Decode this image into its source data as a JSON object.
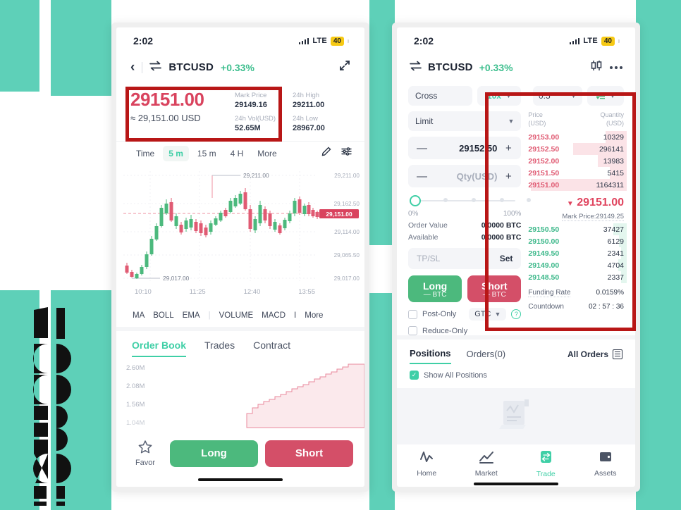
{
  "theme": {
    "teal": "#5ed0b8",
    "accent_green": "#3fcfa6",
    "red": "#d9435e",
    "long_green": "#4cb97d",
    "short_red": "#d44f68",
    "annotation_red": "#b81616"
  },
  "left_phone": {
    "status": {
      "time": "2:02",
      "network": "LTE",
      "battery": "40"
    },
    "header": {
      "back_icon": "chevron-left-icon",
      "swap_icon": "swap-icon",
      "pair": "BTCUSD",
      "change": "+0.33%",
      "expand_icon": "expand-icon"
    },
    "price": {
      "last": "29151.00",
      "approx": "≈ 29,151.00 USD",
      "stats": [
        {
          "label": "Mark Price",
          "value": "29149.16"
        },
        {
          "label": "24h High",
          "value": "29211.00"
        },
        {
          "label": "24h Vol(USD)",
          "value": "52.65M"
        },
        {
          "label": "24h Low",
          "value": "28967.00"
        }
      ]
    },
    "timeframes": [
      {
        "label": "Time",
        "active": false
      },
      {
        "label": "5 m",
        "active": true
      },
      {
        "label": "15 m",
        "active": false
      },
      {
        "label": "4 H",
        "active": false
      },
      {
        "label": "More",
        "active": false
      }
    ],
    "timeframe_icons": [
      "pencil-icon",
      "settings-sliders-icon"
    ],
    "indicators": [
      "MA",
      "BOLL",
      "EMA",
      "VOLUME",
      "MACD",
      "I",
      "More"
    ],
    "order_book_tabs": [
      {
        "label": "Order Book",
        "active": true
      },
      {
        "label": "Trades",
        "active": false
      },
      {
        "label": "Contract",
        "active": false
      }
    ],
    "depth_labels": [
      "2.60M",
      "2.08M",
      "1.56M",
      "1.04M"
    ],
    "bottom": {
      "favor_icon": "star-icon",
      "favor_label": "Favor",
      "long_label": "Long",
      "short_label": "Short"
    }
  },
  "right_phone": {
    "status": {
      "time": "2:02",
      "network": "LTE",
      "battery": "40"
    },
    "header": {
      "swap_icon": "swap-icon",
      "pair": "BTCUSD",
      "change": "+0.33%",
      "candle_icon": "candlestick-icon",
      "more_icon": "more-dots-icon"
    },
    "order_form": {
      "margin_mode": "Cross",
      "leverage": "10x",
      "tick_size": "0.5",
      "depth_icon": "order-depth-icon",
      "order_type": "Limit",
      "price_value": "29152.50",
      "qty_placeholder": "Qty(USD)",
      "minus": "—",
      "plus": "+",
      "slider_min": "0%",
      "slider_max": "100%",
      "order_value_label": "Order Value",
      "order_value": "0.0000 BTC",
      "available_label": "Available",
      "available": "0.0000 BTC",
      "tpsl_label": "TP/SL",
      "tpsl_set": "Set",
      "long_label": "Long",
      "long_sub": "— BTC",
      "short_label": "Short",
      "short_sub": "— BTC",
      "post_only": "Post-Only",
      "reduce_only": "Reduce-Only",
      "tif": "GTC",
      "help_icon": "question-icon"
    },
    "order_book": {
      "header_price": "Price\n(USD)",
      "header_price_l1": "Price",
      "header_price_l2": "(USD)",
      "header_qty_l1": "Quantity",
      "header_qty_l2": "(USD)",
      "asks": [
        {
          "price": "29153.00",
          "qty": "10329",
          "fill": 22
        },
        {
          "price": "29152.50",
          "qty": "296141",
          "fill": 56
        },
        {
          "price": "29152.00",
          "qty": "13983",
          "fill": 30
        },
        {
          "price": "29151.50",
          "qty": "5415",
          "fill": 18
        },
        {
          "price": "29151.00",
          "qty": "1164311",
          "fill": 100
        }
      ],
      "mid": {
        "arrow": "▼",
        "price": "29151.00",
        "mark_price": "Mark Price:29149.25"
      },
      "bids": [
        {
          "price": "29150.50",
          "qty": "37427",
          "fill": 14
        },
        {
          "price": "29150.00",
          "qty": "6129",
          "fill": 8
        },
        {
          "price": "29149.50",
          "qty": "2341",
          "fill": 6
        },
        {
          "price": "29149.00",
          "qty": "4704",
          "fill": 9
        },
        {
          "price": "29148.50",
          "qty": "2337",
          "fill": 6
        }
      ],
      "funding_rate_label": "Funding Rate",
      "funding_rate": "0.0159%",
      "countdown_label": "Countdown",
      "countdown": "02 : 57 : 36"
    },
    "positions": {
      "tabs": [
        {
          "label": "Positions",
          "active": true
        },
        {
          "label": "Orders(0)",
          "active": false
        }
      ],
      "all_orders": "All Orders",
      "all_orders_icon": "list-icon",
      "show_all": "Show All Positions"
    },
    "tabbar": [
      {
        "label": "Home",
        "icon": "pulse-icon",
        "active": false
      },
      {
        "label": "Market",
        "icon": "chart-icon",
        "active": false
      },
      {
        "label": "Trade",
        "icon": "trade-icon",
        "active": true
      },
      {
        "label": "Assets",
        "icon": "wallet-icon",
        "active": false
      }
    ]
  },
  "chart_data": {
    "type": "line",
    "title": "BTCUSD 5m candlestick",
    "xlabel": "",
    "ylabel": "",
    "x_ticks": [
      "10:10",
      "11:25",
      "12:40",
      "13:55"
    ],
    "y_ticks": [
      "29,211.00",
      "29,162.50",
      "29,114.00",
      "29,065.50",
      "29,017.00"
    ],
    "ylim": [
      29017.0,
      29211.0
    ],
    "annotations": [
      {
        "text": "29,211.00",
        "kind": "high-marker"
      },
      {
        "text": "29,017.00",
        "kind": "low-marker"
      },
      {
        "text": "29,151.00",
        "kind": "last-price-tag"
      }
    ],
    "last_price": 29151.0,
    "high": 29211.0,
    "low": 29017.0
  }
}
